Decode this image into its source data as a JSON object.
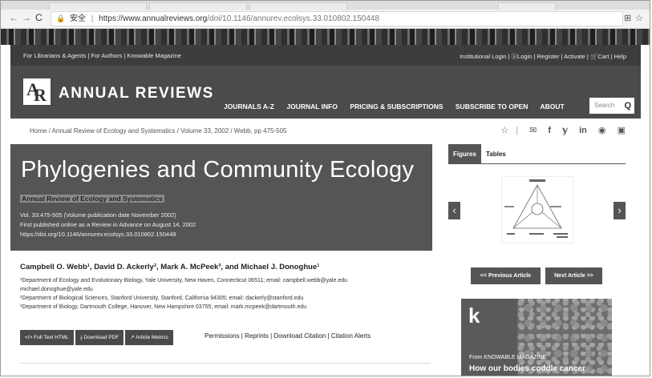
{
  "browser": {
    "secure_label": "安全",
    "url_host": "https://www.annualreviews.org",
    "url_path": "/doi/10.1146/annurev.ecolsys.33.010802.150448"
  },
  "topbar": {
    "left_text": "For Librarians & Agents | For Authors | Knowable Magazine",
    "right_text": "Institutional Login | ⓤLogin | Register | Activate | 🛒Cart | Help"
  },
  "header": {
    "logo_text": "ANNUAL REVIEWS",
    "nav": [
      "JOURNALS A-Z",
      "JOURNAL INFO",
      "PRICING & SUBSCRIPTIONS",
      "SUBSCRIBE TO OPEN",
      "ABOUT"
    ],
    "search_placeholder": "Search"
  },
  "breadcrumb": "Home / Annual Review of Ecology and Systematics / Volume 33, 2002 / Webb, pp 475-505",
  "article": {
    "title": "Phylogenies and Community Ecology",
    "journal": "Annual Review of Ecology and Systematics",
    "vol_line": "Vol. 33:475-505 (Volume publication date November 2002)",
    "published_line": "First published online as a Review in Advance on August 14, 2002",
    "doi_line": "https://doi.org/10.1146/annurev.ecolsys.33.010802.150448",
    "authors": "Campbell O. Webb¹, David D. Ackerly², Mark A. McPeek³, and Michael J. Donoghue¹",
    "affil_1": "¹Department of Ecology and Evolutionary Biology, Yale University, New Haven, Connecticut 06511; email: campbell.webb@yale.edu",
    "affil_1b": "michael.donoghue@yale.edu",
    "affil_2": "²Department of Biological Sciences, Stanford University, Stanford, California 94305; email: dackerly@stanford.edu",
    "affil_3": "³Department of Biology, Dartmouth College, Hanover, New Hampshire 03755; email: mark.mcpeek@dartmouth.edu"
  },
  "actions": {
    "full_text": "Full Text HTML",
    "download_pdf": "Download PDF",
    "metrics": "Article Metrics",
    "links": "Permissions | Reprints | Download Citation | Citation Alerts"
  },
  "side": {
    "tab_figures": "Figures",
    "tab_tables": "Tables",
    "prev_article": "<< Previous Article",
    "next_article": "Next Article >>",
    "promo_k": "k",
    "promo_from": "From KNOWABLE MAGAZINE",
    "promo_headline": "How our bodies coddle cancer"
  }
}
